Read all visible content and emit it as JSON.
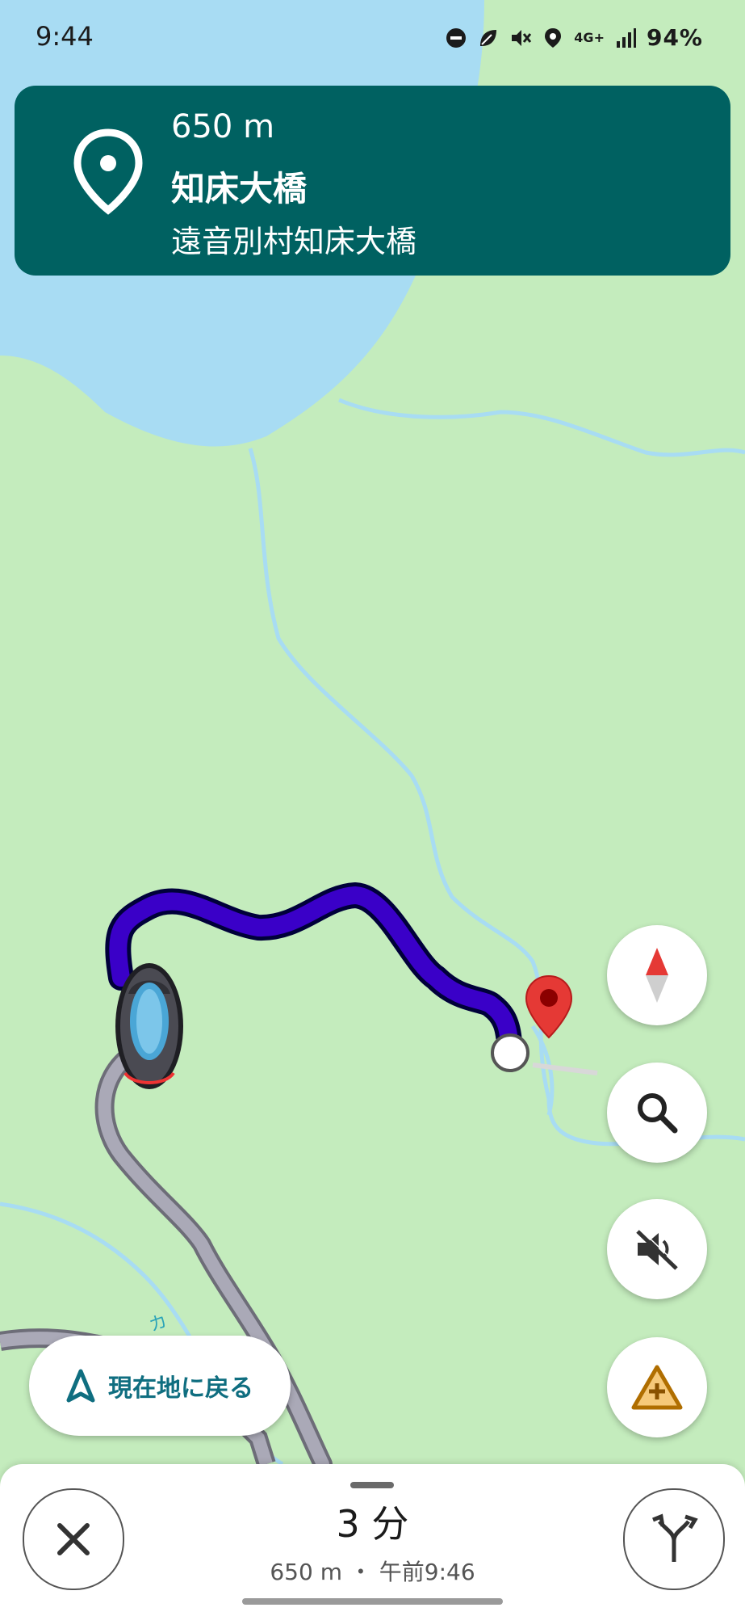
{
  "status_bar": {
    "time": "9:44",
    "network": "4G+",
    "battery": "94%",
    "icons": [
      "do-not-disturb-icon",
      "leaf-icon",
      "vibrate-off-icon",
      "location-icon",
      "signal-icon"
    ]
  },
  "navigation": {
    "distance": "650 m",
    "destination_name": "知床大橋",
    "destination_address": "遠音別村知床大橋",
    "icon": "location-pin-icon"
  },
  "map": {
    "colors": {
      "water": "#a8dcf3",
      "land": "#c4ecbd",
      "route": "#3a00c8",
      "road": "#aaa9b7"
    },
    "road_label": "カ"
  },
  "controls": {
    "compass": "compass-icon",
    "search": "search-icon",
    "mute": "sound-off-icon",
    "report": "report-incident-icon",
    "recenter_label": "現在地に戻る"
  },
  "bottom_sheet": {
    "eta_time": "3 分",
    "eta_detail": "650 m ・ 午前9:46",
    "close": "close-icon",
    "alternate_routes": "alternate-routes-icon"
  }
}
